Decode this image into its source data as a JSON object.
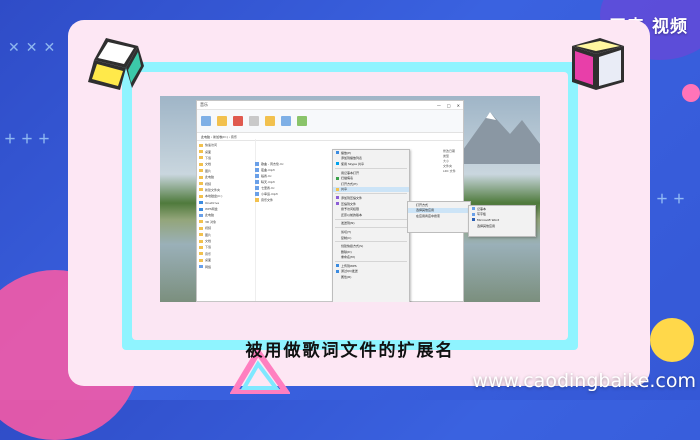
{
  "brand": "王森 视频",
  "subtitle": "被用做歌词文件的扩展名",
  "url": "www.caodingbaike.com",
  "colors": {
    "background": "#3558d6",
    "frame": "#fde7f4",
    "cyan_border": "#8ff4ff",
    "highlight": "#cce4f7"
  },
  "explorer": {
    "title": "音乐",
    "window_buttons": [
      "—",
      "□",
      "✕"
    ],
    "address": "此电脑 › 新加卷(D:) › 音乐",
    "nav_items": [
      "快速访问",
      "桌面",
      "下载",
      "文档",
      "图片",
      "此电脑",
      "视频",
      "新建文件夹",
      "本地磁盘(C:)",
      "OneDrive",
      "WPS网盘",
      "此电脑",
      "3D 对象",
      "视频",
      "图片",
      "文档",
      "下载",
      "音乐",
      "桌面",
      "网络"
    ],
    "files": [
      "歌曲 - 周杰伦.lrc",
      "夜曲.mp3",
      "稻香.lrc",
      "晴天.mp3",
      "七里香.lrc",
      "小幸运.mp3",
      "音乐文件"
    ],
    "details": [
      "修改日期",
      "类型",
      "大小",
      "文件夹",
      "LRC 文件"
    ]
  },
  "context_menu": {
    "items": [
      "播放(P)",
      "添加到播放列表",
      "使用 Skype 共享",
      "用记事本打开",
      "扫描病毒",
      "打开方式(H)",
      "共享",
      "添加到压缩文件",
      "压缩到文件",
      "授予访问权限",
      "还原以前的版本",
      "发送到(N)",
      "剪切(T)",
      "复制(C)",
      "创建快捷方式(S)",
      "删除(D)",
      "重命名(M)",
      "上传到WPS",
      "通过QQ发送",
      "属性(R)"
    ],
    "highlighted_index": 6
  },
  "submenu": {
    "items": [
      "打开方式",
      "选择其他应用",
      "在应用商店中搜索"
    ]
  },
  "submenu2": {
    "items": [
      "记事本",
      "写字板",
      "Microsoft Word",
      "选择其他应用"
    ]
  }
}
